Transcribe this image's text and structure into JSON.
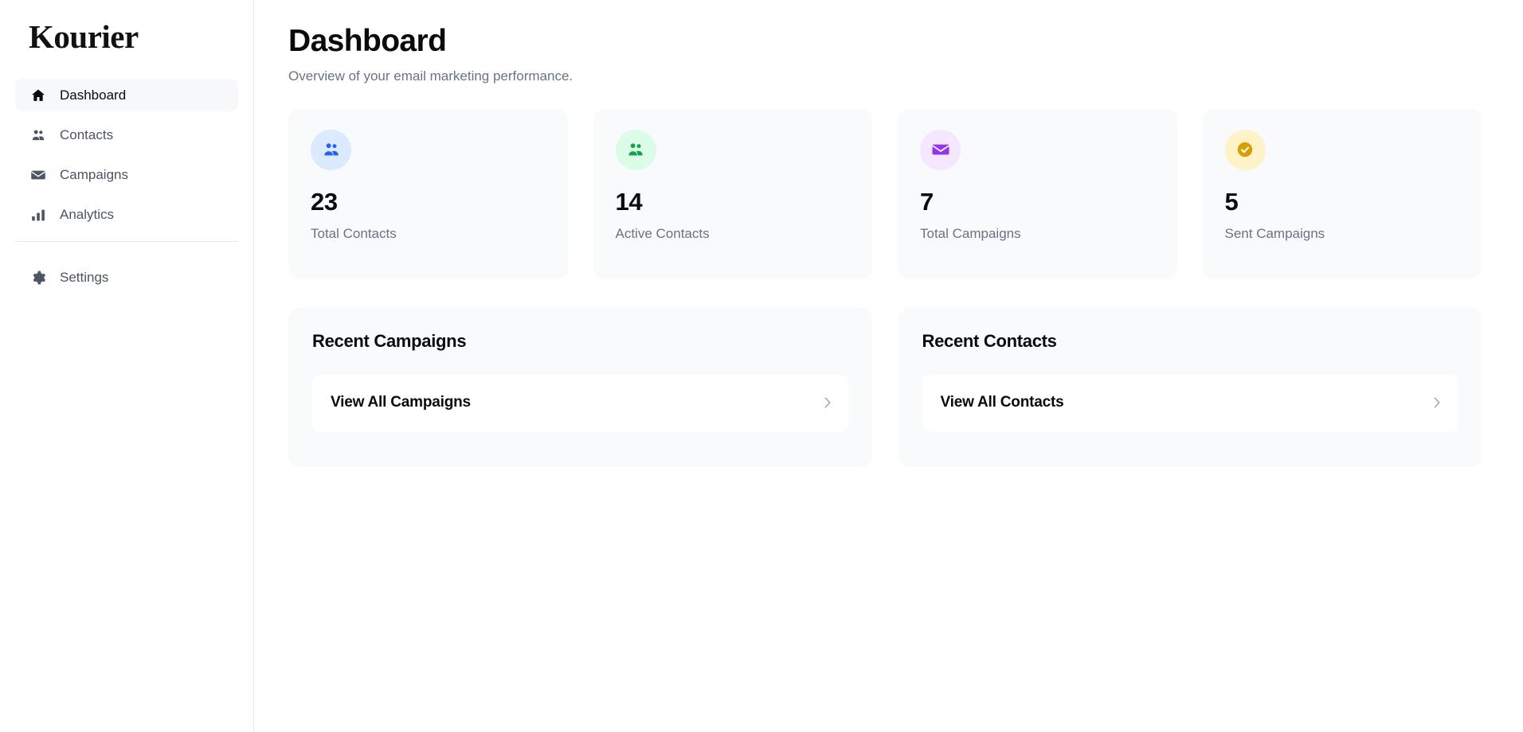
{
  "app": {
    "logo": "Kourier"
  },
  "sidebar": {
    "items": [
      {
        "label": "Dashboard",
        "icon": "home-icon",
        "active": true
      },
      {
        "label": "Contacts",
        "icon": "people-icon",
        "active": false
      },
      {
        "label": "Campaigns",
        "icon": "mail-icon",
        "active": false
      },
      {
        "label": "Analytics",
        "icon": "bar-chart-icon",
        "active": false
      }
    ],
    "lower_items": [
      {
        "label": "Settings",
        "icon": "gear-icon",
        "active": false
      }
    ]
  },
  "header": {
    "title": "Dashboard",
    "subtitle": "Overview of your email marketing performance."
  },
  "stats": [
    {
      "value": "23",
      "label": "Total Contacts",
      "icon": "people-icon",
      "icon_color": "#2563eb",
      "icon_bg": "#dbeafe"
    },
    {
      "value": "14",
      "label": "Active Contacts",
      "icon": "people-icon",
      "icon_color": "#16a34a",
      "icon_bg": "#dcfce7"
    },
    {
      "value": "7",
      "label": "Total Campaigns",
      "icon": "mail-icon",
      "icon_color": "#9333ea",
      "icon_bg": "#f3e8ff"
    },
    {
      "value": "5",
      "label": "Sent Campaigns",
      "icon": "check-circle-icon",
      "icon_color": "#d69e00",
      "icon_bg": "#fef3c7"
    }
  ],
  "panels": [
    {
      "title": "Recent Campaigns",
      "row_label": "View All Campaigns",
      "row_icon": "chevron-right-icon"
    },
    {
      "title": "Recent Contacts",
      "row_label": "View All Contacts",
      "row_icon": "chevron-right-icon"
    }
  ],
  "colors": {
    "card_bg": "#f8fafc",
    "page_bg": "#ffffff",
    "text_primary": "#0b0b0d",
    "text_muted": "#6b7280",
    "nav_text": "#4b5563",
    "border": "#e8e8ec"
  }
}
